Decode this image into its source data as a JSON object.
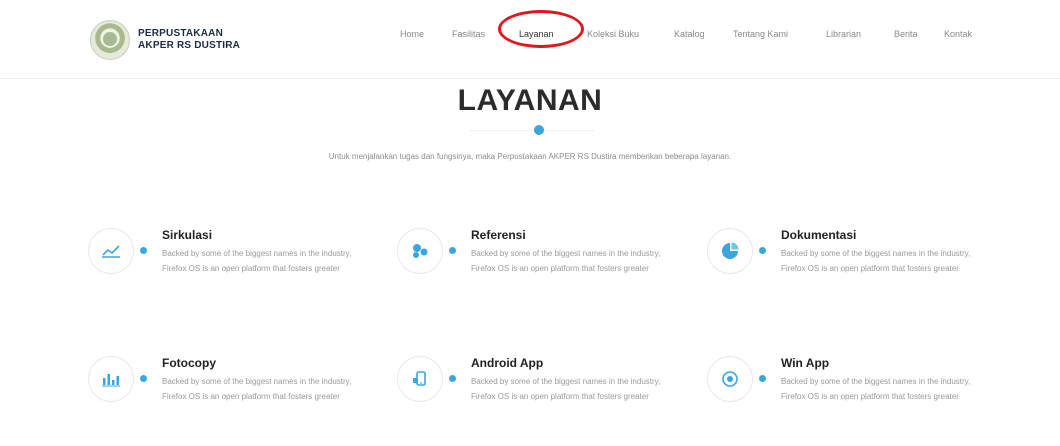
{
  "brand": {
    "line1": "PERPUSTAKAAN",
    "line2": "AKPER RS DUSTIRA"
  },
  "nav": [
    {
      "label": "Home"
    },
    {
      "label": "Fasilitas"
    },
    {
      "label": "Layanan"
    },
    {
      "label": "Koleksi Buku"
    },
    {
      "label": "Katalog"
    },
    {
      "label": "Tentang Kami"
    },
    {
      "label": "Librarian"
    },
    {
      "label": "Berita"
    },
    {
      "label": "Kontak"
    }
  ],
  "section": {
    "title": "LAYANAN",
    "intro": "Untuk menjalankan tugas dan fungsinya, maka Perpustakaan AKPER RS Dustira memberikan beberapa layanan."
  },
  "services": [
    {
      "title": "Sirkulasi",
      "desc": "Backed by some of the biggest names in the industry, Firefox OS is an open platform that fosters greater",
      "icon": "line-chart-icon"
    },
    {
      "title": "Referensi",
      "desc": "Backed by some of the biggest names in the industry, Firefox OS is an open platform that fosters greater",
      "icon": "cluster-icon"
    },
    {
      "title": "Dokumentasi",
      "desc": "Backed by some of the biggest names in the industry, Firefox OS is an open platform that fosters greater",
      "icon": "pie-chart-icon"
    },
    {
      "title": "Fotocopy",
      "desc": "Backed by some of the biggest names in the industry, Firefox OS is an open platform that fosters greater",
      "icon": "bar-chart-icon"
    },
    {
      "title": "Android App",
      "desc": "Backed by some of the biggest names in the industry, Firefox OS is an open platform that fosters greater",
      "icon": "mobile-icon"
    },
    {
      "title": "Win App",
      "desc": "Backed by some of the biggest names in the industry, Firefox OS is an open platform that fosters greater",
      "icon": "target-icon"
    }
  ],
  "colors": {
    "accent": "#3aa6dd",
    "highlight": "#e2161d"
  }
}
